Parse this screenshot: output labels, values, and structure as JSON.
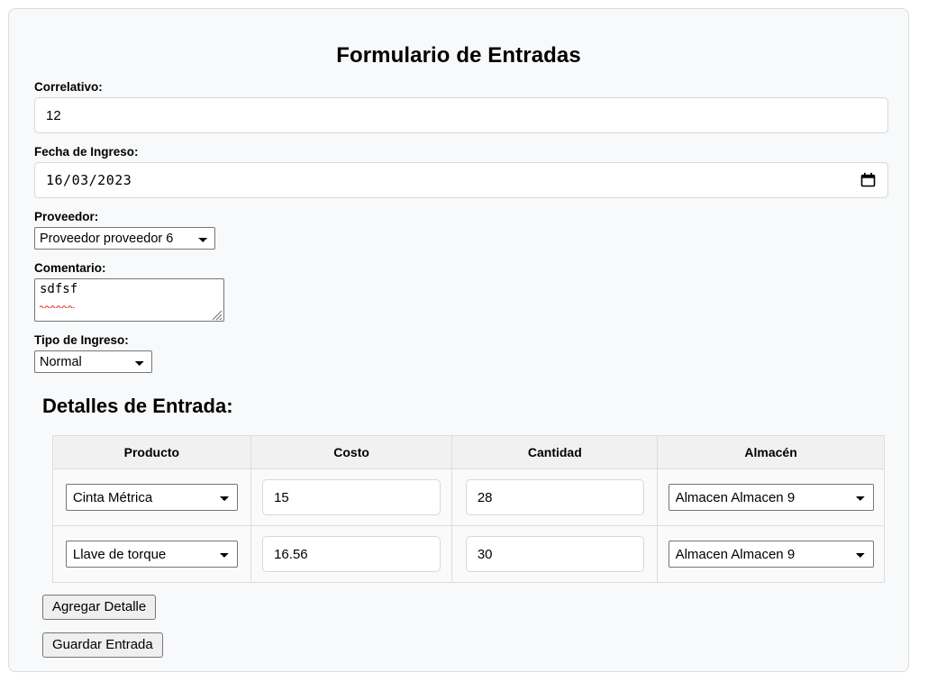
{
  "form": {
    "title": "Formulario de Entradas",
    "fields": {
      "correlativo": {
        "label": "Correlativo:",
        "value": "12",
        "placeholder": ""
      },
      "fecha_ingreso": {
        "label": "Fecha de Ingreso:",
        "value": "16/03/2023",
        "icon": "calendar-icon"
      },
      "proveedor": {
        "label": "Proveedor:",
        "selected": "Proveedor proveedor 6",
        "icon": "chevron-down-icon"
      },
      "comentario": {
        "label": "Comentario:",
        "value": "sdfsf",
        "placeholder": ""
      },
      "tipo_ingreso": {
        "label": "Tipo de Ingreso:",
        "selected": "Normal",
        "icon": "chevron-down-icon"
      }
    }
  },
  "details": {
    "heading": "Detalles de Entrada:",
    "columns": [
      "Producto",
      "Costo",
      "Cantidad",
      "Almacén"
    ],
    "rows": [
      {
        "producto": "Cinta Métrica",
        "costo": "15",
        "cantidad": "28",
        "almacen": "Almacen Almacen 9"
      },
      {
        "producto": "Llave de torque",
        "costo": "16.56",
        "cantidad": "30",
        "almacen": "Almacen Almacen 9"
      }
    ]
  },
  "actions": {
    "add_detail": "Agregar Detalle",
    "save_entry": "Guardar Entrada"
  },
  "colors": {
    "card_background": "#f8f9fa",
    "card_border": "#dddddd",
    "table_header_background": "#f1f1f1",
    "table_border": "#dddddd",
    "input_border": "#d8d8d8",
    "control_border": "#767676",
    "button_background": "#efefef",
    "text": "#000000",
    "spellcheck_underline": "#e53935"
  }
}
